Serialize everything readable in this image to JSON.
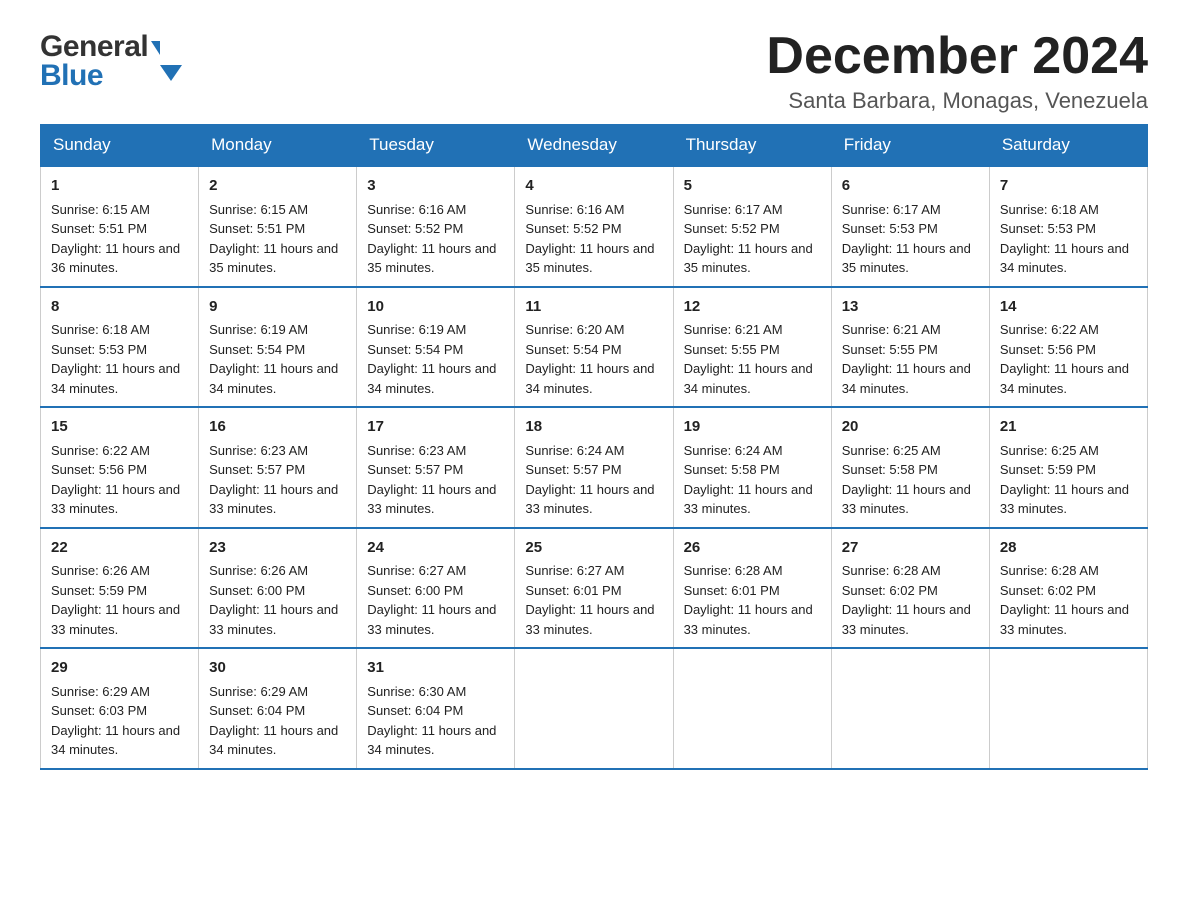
{
  "logo": {
    "general": "General",
    "blue": "Blue"
  },
  "title": {
    "month_year": "December 2024",
    "location": "Santa Barbara, Monagas, Venezuela"
  },
  "headers": [
    "Sunday",
    "Monday",
    "Tuesday",
    "Wednesday",
    "Thursday",
    "Friday",
    "Saturday"
  ],
  "weeks": [
    [
      {
        "day": "1",
        "sunrise": "6:15 AM",
        "sunset": "5:51 PM",
        "daylight": "11 hours and 36 minutes."
      },
      {
        "day": "2",
        "sunrise": "6:15 AM",
        "sunset": "5:51 PM",
        "daylight": "11 hours and 35 minutes."
      },
      {
        "day": "3",
        "sunrise": "6:16 AM",
        "sunset": "5:52 PM",
        "daylight": "11 hours and 35 minutes."
      },
      {
        "day": "4",
        "sunrise": "6:16 AM",
        "sunset": "5:52 PM",
        "daylight": "11 hours and 35 minutes."
      },
      {
        "day": "5",
        "sunrise": "6:17 AM",
        "sunset": "5:52 PM",
        "daylight": "11 hours and 35 minutes."
      },
      {
        "day": "6",
        "sunrise": "6:17 AM",
        "sunset": "5:53 PM",
        "daylight": "11 hours and 35 minutes."
      },
      {
        "day": "7",
        "sunrise": "6:18 AM",
        "sunset": "5:53 PM",
        "daylight": "11 hours and 34 minutes."
      }
    ],
    [
      {
        "day": "8",
        "sunrise": "6:18 AM",
        "sunset": "5:53 PM",
        "daylight": "11 hours and 34 minutes."
      },
      {
        "day": "9",
        "sunrise": "6:19 AM",
        "sunset": "5:54 PM",
        "daylight": "11 hours and 34 minutes."
      },
      {
        "day": "10",
        "sunrise": "6:19 AM",
        "sunset": "5:54 PM",
        "daylight": "11 hours and 34 minutes."
      },
      {
        "day": "11",
        "sunrise": "6:20 AM",
        "sunset": "5:54 PM",
        "daylight": "11 hours and 34 minutes."
      },
      {
        "day": "12",
        "sunrise": "6:21 AM",
        "sunset": "5:55 PM",
        "daylight": "11 hours and 34 minutes."
      },
      {
        "day": "13",
        "sunrise": "6:21 AM",
        "sunset": "5:55 PM",
        "daylight": "11 hours and 34 minutes."
      },
      {
        "day": "14",
        "sunrise": "6:22 AM",
        "sunset": "5:56 PM",
        "daylight": "11 hours and 34 minutes."
      }
    ],
    [
      {
        "day": "15",
        "sunrise": "6:22 AM",
        "sunset": "5:56 PM",
        "daylight": "11 hours and 33 minutes."
      },
      {
        "day": "16",
        "sunrise": "6:23 AM",
        "sunset": "5:57 PM",
        "daylight": "11 hours and 33 minutes."
      },
      {
        "day": "17",
        "sunrise": "6:23 AM",
        "sunset": "5:57 PM",
        "daylight": "11 hours and 33 minutes."
      },
      {
        "day": "18",
        "sunrise": "6:24 AM",
        "sunset": "5:57 PM",
        "daylight": "11 hours and 33 minutes."
      },
      {
        "day": "19",
        "sunrise": "6:24 AM",
        "sunset": "5:58 PM",
        "daylight": "11 hours and 33 minutes."
      },
      {
        "day": "20",
        "sunrise": "6:25 AM",
        "sunset": "5:58 PM",
        "daylight": "11 hours and 33 minutes."
      },
      {
        "day": "21",
        "sunrise": "6:25 AM",
        "sunset": "5:59 PM",
        "daylight": "11 hours and 33 minutes."
      }
    ],
    [
      {
        "day": "22",
        "sunrise": "6:26 AM",
        "sunset": "5:59 PM",
        "daylight": "11 hours and 33 minutes."
      },
      {
        "day": "23",
        "sunrise": "6:26 AM",
        "sunset": "6:00 PM",
        "daylight": "11 hours and 33 minutes."
      },
      {
        "day": "24",
        "sunrise": "6:27 AM",
        "sunset": "6:00 PM",
        "daylight": "11 hours and 33 minutes."
      },
      {
        "day": "25",
        "sunrise": "6:27 AM",
        "sunset": "6:01 PM",
        "daylight": "11 hours and 33 minutes."
      },
      {
        "day": "26",
        "sunrise": "6:28 AM",
        "sunset": "6:01 PM",
        "daylight": "11 hours and 33 minutes."
      },
      {
        "day": "27",
        "sunrise": "6:28 AM",
        "sunset": "6:02 PM",
        "daylight": "11 hours and 33 minutes."
      },
      {
        "day": "28",
        "sunrise": "6:28 AM",
        "sunset": "6:02 PM",
        "daylight": "11 hours and 33 minutes."
      }
    ],
    [
      {
        "day": "29",
        "sunrise": "6:29 AM",
        "sunset": "6:03 PM",
        "daylight": "11 hours and 34 minutes."
      },
      {
        "day": "30",
        "sunrise": "6:29 AM",
        "sunset": "6:04 PM",
        "daylight": "11 hours and 34 minutes."
      },
      {
        "day": "31",
        "sunrise": "6:30 AM",
        "sunset": "6:04 PM",
        "daylight": "11 hours and 34 minutes."
      },
      null,
      null,
      null,
      null
    ]
  ]
}
